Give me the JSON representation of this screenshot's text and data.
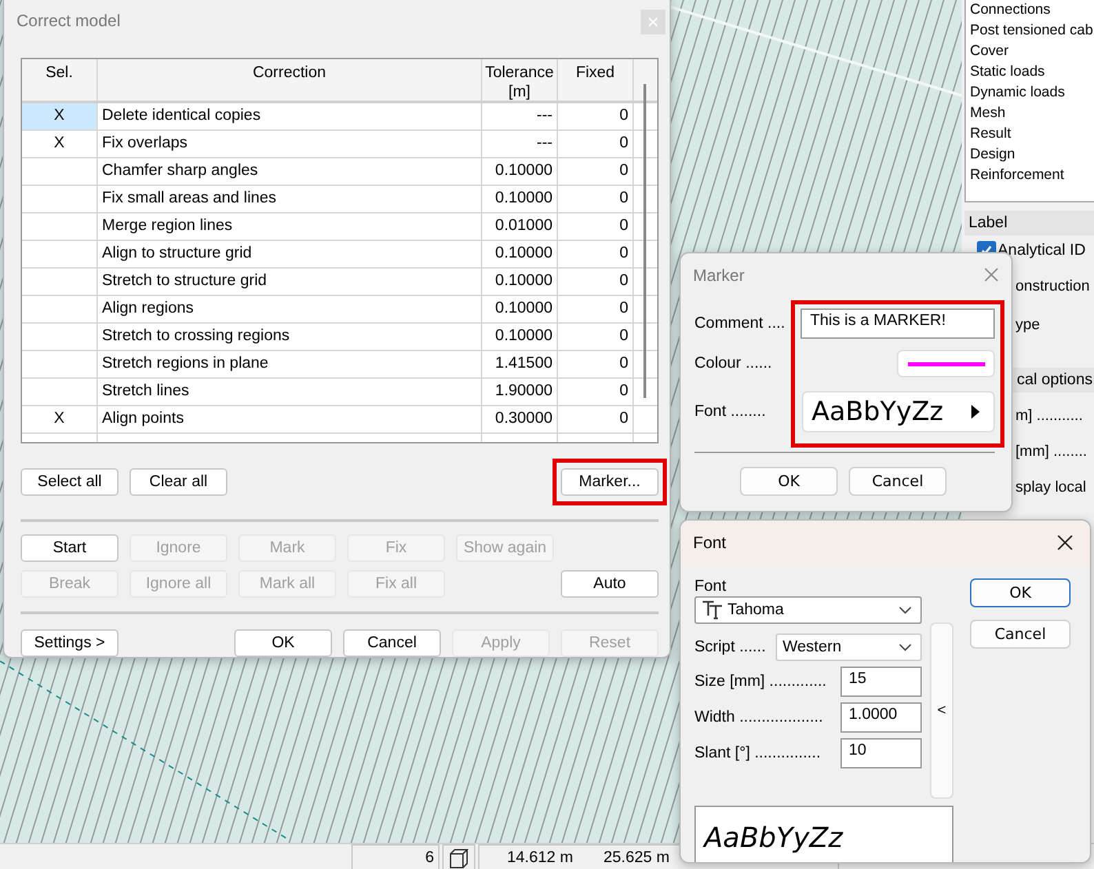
{
  "side_panel": {
    "list": [
      "Connections",
      "Post tensioned cab",
      "Cover",
      "Static loads",
      "Dynamic loads",
      "Mesh",
      "Result",
      "Design",
      "Reinforcement"
    ],
    "label_section": "Label",
    "analytical_id": {
      "label": "Analytical ID",
      "checked": true
    },
    "partial_texts_1": [
      "onstruction",
      "ype"
    ],
    "options_section": "cal options",
    "partial_texts_2": [
      "m] ...........",
      "[mm] ........",
      "splay local"
    ]
  },
  "correct_model": {
    "title": "Correct model",
    "columns": [
      "Sel.",
      "Correction",
      "Tolerance [m]",
      "Fixed"
    ],
    "rows": [
      {
        "sel": "X",
        "correction": "Delete identical copies",
        "tolerance": "---",
        "fixed": "0",
        "selected": true
      },
      {
        "sel": "X",
        "correction": "Fix overlaps",
        "tolerance": "---",
        "fixed": "0",
        "selected": false
      },
      {
        "sel": "",
        "correction": "Chamfer sharp angles",
        "tolerance": "0.10000",
        "fixed": "0",
        "selected": false
      },
      {
        "sel": "",
        "correction": "Fix small areas and lines",
        "tolerance": "0.10000",
        "fixed": "0",
        "selected": false
      },
      {
        "sel": "",
        "correction": "Merge region lines",
        "tolerance": "0.01000",
        "fixed": "0",
        "selected": false
      },
      {
        "sel": "",
        "correction": "Align to structure grid",
        "tolerance": "0.10000",
        "fixed": "0",
        "selected": false
      },
      {
        "sel": "",
        "correction": "Stretch to structure grid",
        "tolerance": "0.10000",
        "fixed": "0",
        "selected": false
      },
      {
        "sel": "",
        "correction": "Align regions",
        "tolerance": "0.10000",
        "fixed": "0",
        "selected": false
      },
      {
        "sel": "",
        "correction": "Stretch to crossing regions",
        "tolerance": "0.10000",
        "fixed": "0",
        "selected": false
      },
      {
        "sel": "",
        "correction": "Stretch regions in plane",
        "tolerance": "1.41500",
        "fixed": "0",
        "selected": false
      },
      {
        "sel": "",
        "correction": "Stretch lines",
        "tolerance": "1.90000",
        "fixed": "0",
        "selected": false
      },
      {
        "sel": "X",
        "correction": "Align points",
        "tolerance": "0.30000",
        "fixed": "0",
        "selected": false
      }
    ],
    "select_buttons": [
      {
        "label": "Select all",
        "disabled": false
      },
      {
        "label": "Clear all",
        "disabled": false
      }
    ],
    "marker_button": {
      "label": "Marker...",
      "highlighted": true
    },
    "action_row_1": [
      {
        "label": "Start",
        "disabled": false
      },
      {
        "label": "Ignore",
        "disabled": true
      },
      {
        "label": "Mark",
        "disabled": true
      },
      {
        "label": "Fix",
        "disabled": true
      },
      {
        "label": "Show again",
        "disabled": true
      }
    ],
    "action_row_2": [
      {
        "label": "Break",
        "disabled": true
      },
      {
        "label": "Ignore all",
        "disabled": true
      },
      {
        "label": "Mark all",
        "disabled": true
      },
      {
        "label": "Fix all",
        "disabled": true
      }
    ],
    "auto_button": {
      "label": "Auto",
      "disabled": false
    },
    "settings_button": "Settings >",
    "footer_buttons": [
      {
        "label": "OK",
        "disabled": false
      },
      {
        "label": "Cancel",
        "disabled": false
      },
      {
        "label": "Apply",
        "disabled": true
      },
      {
        "label": "Reset",
        "disabled": true
      }
    ]
  },
  "marker": {
    "title": "Marker",
    "comment_label": "Comment ....",
    "comment_value": "This is a MARKER!",
    "colour_label": "Colour ......",
    "colour": {
      "color": "#ff00ff"
    },
    "font_label": "Font ........",
    "font_sample": "AaBbYyZz",
    "highlighted": true,
    "buttons": [
      "OK",
      "Cancel"
    ]
  },
  "font_dialog": {
    "title": "Font",
    "font_label": "Font",
    "font_value": "Tahoma",
    "script_label": "Script ......",
    "script_value": "Western",
    "size_label": "Size [mm] .............",
    "size_value": "15",
    "width_label": "Width ...................",
    "width_value": "1.0000",
    "slant_label": "Slant [°] ...............",
    "slant_value": "10",
    "side_button": "<",
    "preview": "AaBbYyZz",
    "buttons": [
      {
        "label": "OK",
        "default": true
      },
      {
        "label": "Cancel",
        "default": false
      }
    ]
  },
  "status_bar": {
    "count": "6",
    "x": "14.612 m",
    "y": "25.625 m"
  }
}
